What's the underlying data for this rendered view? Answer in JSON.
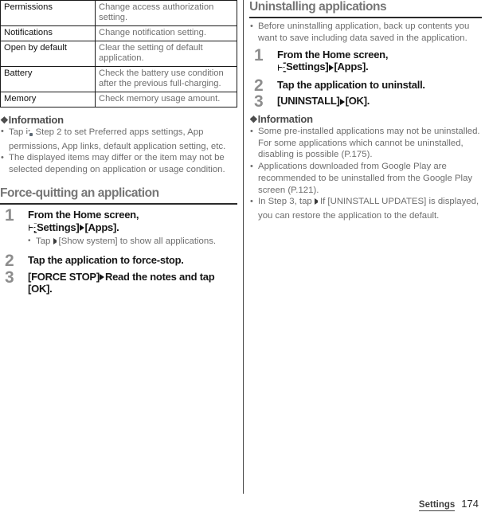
{
  "page": {
    "number": "174",
    "section_footer": "Settings"
  },
  "left_column": {
    "table": {
      "rows": [
        {
          "key": "Permissions",
          "value": "Change access authorization setting."
        },
        {
          "key": "Notifications",
          "value": "Change notification setting."
        },
        {
          "key": "Open by default",
          "value": "Clear the setting of default application."
        },
        {
          "key": "Battery",
          "value": "Check the battery use condition after the previous full-charging."
        },
        {
          "key": "Memory",
          "value": "Check memory usage amount."
        }
      ]
    },
    "information": {
      "heading": "Information",
      "glyph": "❖",
      "bullets": [
        {
          "pre": "Tap ",
          "icon": "gear-icon",
          "post": " in Step 2 to set Preferred apps settings, App permissions, App links, default application setting, etc."
        },
        {
          "pre": "The displayed items may differ or the item may not be selected depending on application or usage condition.",
          "icon": "",
          "post": ""
        }
      ]
    },
    "section": {
      "title": "Force-quitting an application",
      "steps": [
        {
          "num": "1",
          "line1": "From the Home screen,",
          "icon1": "apps-grid-icon",
          "mid1": "[Settings]",
          "mid2": "[Apps].",
          "sub_pre": "Tap ",
          "sub_icon": "overflow-menu-icon",
          "sub_post": "[Show system] to show all applications."
        },
        {
          "num": "2",
          "line1": "Tap the application to force-stop."
        },
        {
          "num": "3",
          "line1": "[FORCE STOP]",
          "line2": "Read the notes and tap [OK]."
        }
      ]
    }
  },
  "right_column": {
    "section": {
      "title": "Uninstalling applications",
      "lead_bullet": "Before uninstalling application, back up contents you want to save including data saved in the application.",
      "steps": [
        {
          "num": "1",
          "line1": "From the Home screen,",
          "icon1": "apps-grid-icon",
          "mid1": "[Settings]",
          "mid2": "[Apps]."
        },
        {
          "num": "2",
          "line1": "Tap the application to uninstall."
        },
        {
          "num": "3",
          "line1": "[UNINSTALL]",
          "line2": "[OK]."
        }
      ]
    },
    "information": {
      "heading": "Information",
      "glyph": "❖",
      "bullets": [
        {
          "pre": "Some pre-installed applications may not be uninstalled. For some applications which cannot be uninstalled, disabling is possible (P.175).",
          "icon": "",
          "post": ""
        },
        {
          "pre": "Applications downloaded from Google Play are recommended to be uninstalled from the Google Play screen (P.121).",
          "icon": "",
          "post": ""
        },
        {
          "pre": "In Step 3, tap ",
          "icon": "overflow-menu-icon",
          "post": "If [UNINSTALL UPDATES] is displayed, you can restore the application to the default."
        }
      ]
    }
  },
  "colors": {
    "heading_gray": "#767676",
    "body_gray": "#6e6e6e",
    "rule_dark": "#2b2b2b",
    "step_num_gray": "#8d8d8d",
    "icon_slate": "#525f6b"
  }
}
